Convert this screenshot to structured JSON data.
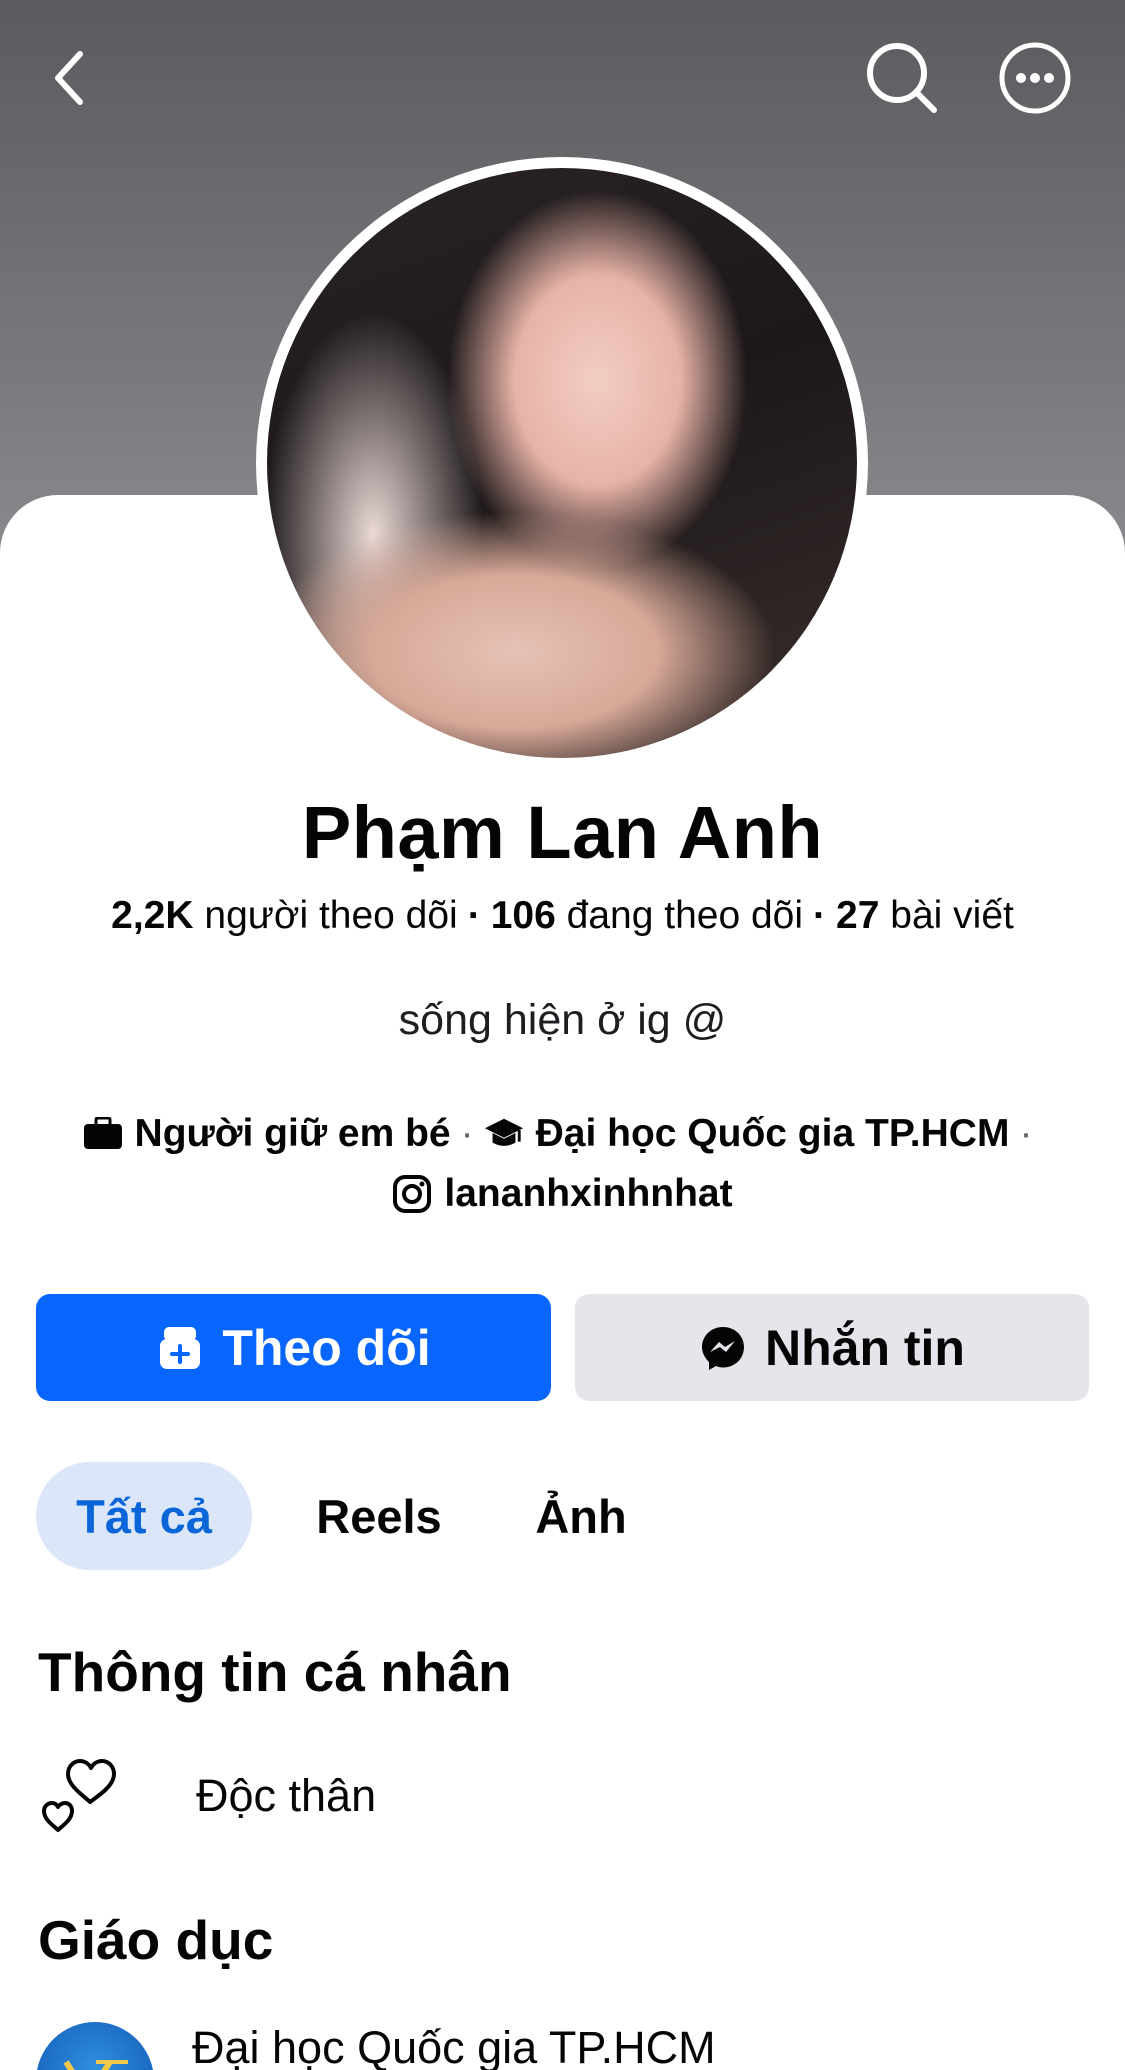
{
  "profile": {
    "name": "Phạm Lan Anh",
    "followers": "2,2K",
    "followers_label": "người theo dõi",
    "following": "106",
    "following_label": "đang theo dõi",
    "posts": "27",
    "posts_label": "bài viết",
    "separator": "·",
    "bio": "sống hiện ở ig @"
  },
  "details": {
    "work": "Người giữ em bé",
    "school": "Đại học Quốc gia TP.HCM",
    "instagram": "lananhxinhnhat",
    "separator": "·"
  },
  "actions": {
    "follow_label": "Theo dõi",
    "message_label": "Nhắn tin"
  },
  "tabs": [
    {
      "label": "Tất cả",
      "active": true
    },
    {
      "label": "Reels",
      "active": false
    },
    {
      "label": "Ảnh",
      "active": false
    }
  ],
  "personal_info": {
    "title": "Thông tin cá nhân",
    "relationship": "Độc thân"
  },
  "education": {
    "title": "Giáo dục",
    "school": "Đại học Quốc gia TP.HCM"
  },
  "icons": {
    "back": "chevron-left-icon",
    "search": "search-icon",
    "more": "more-options-icon",
    "work": "briefcase-icon",
    "school": "graduation-cap-icon",
    "instagram": "instagram-icon",
    "follow": "add-friend-icon",
    "message": "messenger-icon",
    "relationship": "hearts-icon"
  },
  "colors": {
    "primary": "#0866ff",
    "secondary_button": "#e4e6eb",
    "active_tab_bg": "#dbe7f9",
    "active_tab_text": "#0a66d8"
  }
}
